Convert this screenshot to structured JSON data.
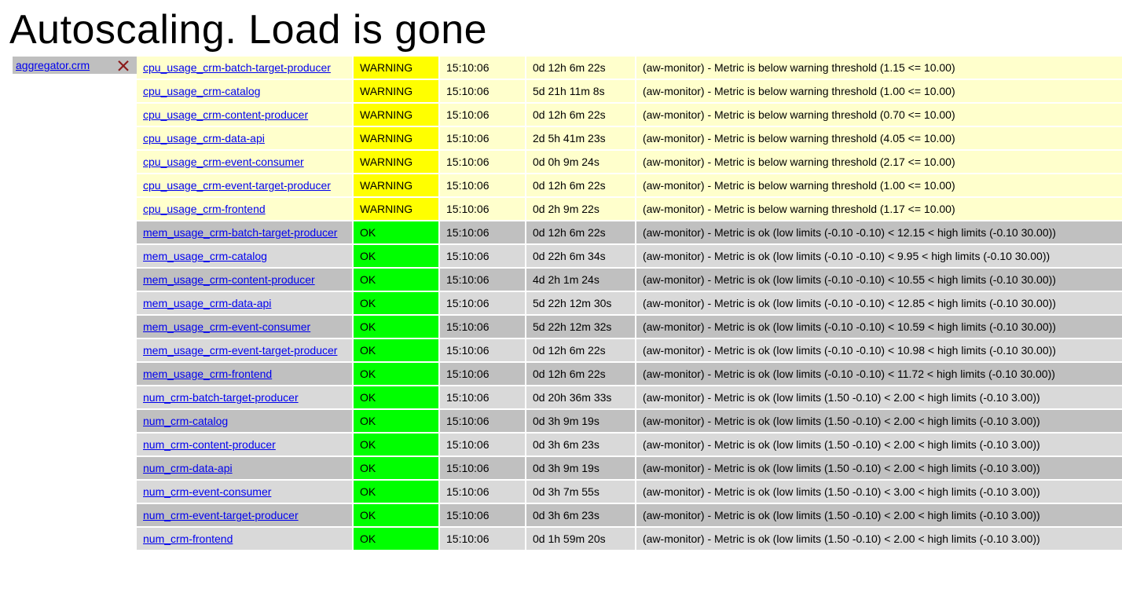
{
  "title": "Autoscaling. Load is gone",
  "sidebar": {
    "host_label": "aggregator.crm",
    "icon_name": "status-bad-icon"
  },
  "rows": [
    {
      "metric": "cpu_usage_crm-batch-target-producer",
      "status": "WARNING",
      "time": "15:10:06",
      "duration": "0d 12h 6m 22s",
      "info": "(aw-monitor) - Metric is below warning threshold (1.15 <= 10.00)"
    },
    {
      "metric": "cpu_usage_crm-catalog",
      "status": "WARNING",
      "time": "15:10:06",
      "duration": "5d 21h 11m 8s",
      "info": "(aw-monitor) - Metric is below warning threshold (1.00 <= 10.00)"
    },
    {
      "metric": "cpu_usage_crm-content-producer",
      "status": "WARNING",
      "time": "15:10:06",
      "duration": "0d 12h 6m 22s",
      "info": "(aw-monitor) - Metric is below warning threshold (0.70 <= 10.00)"
    },
    {
      "metric": "cpu_usage_crm-data-api",
      "status": "WARNING",
      "time": "15:10:06",
      "duration": "2d 5h 41m 23s",
      "info": "(aw-monitor) - Metric is below warning threshold (4.05 <= 10.00)"
    },
    {
      "metric": "cpu_usage_crm-event-consumer",
      "status": "WARNING",
      "time": "15:10:06",
      "duration": "0d 0h 9m 24s",
      "info": "(aw-monitor) - Metric is below warning threshold (2.17 <= 10.00)"
    },
    {
      "metric": "cpu_usage_crm-event-target-producer",
      "status": "WARNING",
      "time": "15:10:06",
      "duration": "0d 12h 6m 22s",
      "info": "(aw-monitor) - Metric is below warning threshold (1.00 <= 10.00)"
    },
    {
      "metric": "cpu_usage_crm-frontend",
      "status": "WARNING",
      "time": "15:10:06",
      "duration": "0d 2h 9m 22s",
      "info": "(aw-monitor) - Metric is below warning threshold (1.17 <= 10.00)"
    },
    {
      "metric": "mem_usage_crm-batch-target-producer",
      "status": "OK",
      "time": "15:10:06",
      "duration": "0d 12h 6m 22s",
      "info": "(aw-monitor) - Metric is ok (low limits (-0.10 -0.10) < 12.15 < high limits (-0.10 30.00))"
    },
    {
      "metric": "mem_usage_crm-catalog",
      "status": "OK",
      "time": "15:10:06",
      "duration": "0d 22h 6m 34s",
      "info": "(aw-monitor) - Metric is ok (low limits (-0.10 -0.10) < 9.95 < high limits (-0.10 30.00))"
    },
    {
      "metric": "mem_usage_crm-content-producer",
      "status": "OK",
      "time": "15:10:06",
      "duration": "4d 2h 1m 24s",
      "info": "(aw-monitor) - Metric is ok (low limits (-0.10 -0.10) < 10.55 < high limits (-0.10 30.00))"
    },
    {
      "metric": "mem_usage_crm-data-api",
      "status": "OK",
      "time": "15:10:06",
      "duration": "5d 22h 12m 30s",
      "info": "(aw-monitor) - Metric is ok (low limits (-0.10 -0.10) < 12.85 < high limits (-0.10 30.00))"
    },
    {
      "metric": "mem_usage_crm-event-consumer",
      "status": "OK",
      "time": "15:10:06",
      "duration": "5d 22h 12m 32s",
      "info": "(aw-monitor) - Metric is ok (low limits (-0.10 -0.10) < 10.59 < high limits (-0.10 30.00))"
    },
    {
      "metric": "mem_usage_crm-event-target-producer",
      "status": "OK",
      "time": "15:10:06",
      "duration": "0d 12h 6m 22s",
      "info": "(aw-monitor) - Metric is ok (low limits (-0.10 -0.10) < 10.98 < high limits (-0.10 30.00))"
    },
    {
      "metric": "mem_usage_crm-frontend",
      "status": "OK",
      "time": "15:10:06",
      "duration": "0d 12h 6m 22s",
      "info": "(aw-monitor) - Metric is ok (low limits (-0.10 -0.10) < 11.72 < high limits (-0.10 30.00))"
    },
    {
      "metric": "num_crm-batch-target-producer",
      "status": "OK",
      "time": "15:10:06",
      "duration": "0d 20h 36m 33s",
      "info": "(aw-monitor) - Metric is ok (low limits (1.50 -0.10) < 2.00 < high limits (-0.10 3.00))"
    },
    {
      "metric": "num_crm-catalog",
      "status": "OK",
      "time": "15:10:06",
      "duration": "0d 3h 9m 19s",
      "info": "(aw-monitor) - Metric is ok (low limits (1.50 -0.10) < 2.00 < high limits (-0.10 3.00))"
    },
    {
      "metric": "num_crm-content-producer",
      "status": "OK",
      "time": "15:10:06",
      "duration": "0d 3h 6m 23s",
      "info": "(aw-monitor) - Metric is ok (low limits (1.50 -0.10) < 2.00 < high limits (-0.10 3.00))"
    },
    {
      "metric": "num_crm-data-api",
      "status": "OK",
      "time": "15:10:06",
      "duration": "0d 3h 9m 19s",
      "info": "(aw-monitor) - Metric is ok (low limits (1.50 -0.10) < 2.00 < high limits (-0.10 3.00))"
    },
    {
      "metric": "num_crm-event-consumer",
      "status": "OK",
      "time": "15:10:06",
      "duration": "0d 3h 7m 55s",
      "info": "(aw-monitor) - Metric is ok (low limits (1.50 -0.10) < 3.00 < high limits (-0.10 3.00))"
    },
    {
      "metric": "num_crm-event-target-producer",
      "status": "OK",
      "time": "15:10:06",
      "duration": "0d 3h 6m 23s",
      "info": "(aw-monitor) - Metric is ok (low limits (1.50 -0.10) < 2.00 < high limits (-0.10 3.00))"
    },
    {
      "metric": "num_crm-frontend",
      "status": "OK",
      "time": "15:10:06",
      "duration": "0d 1h 59m 20s",
      "info": "(aw-monitor) - Metric is ok (low limits (1.50 -0.10) < 2.00 < high limits (-0.10 3.00))"
    }
  ]
}
